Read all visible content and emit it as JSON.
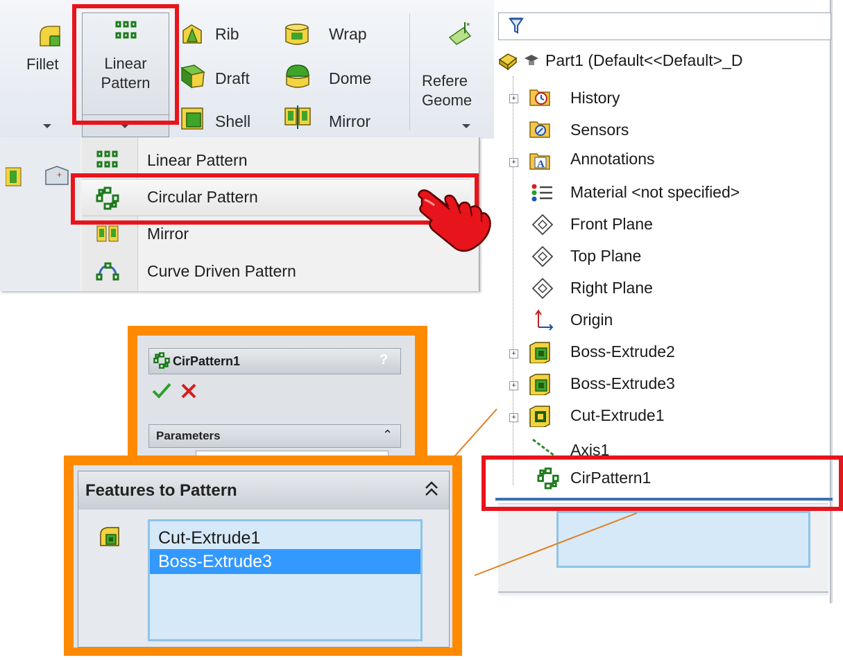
{
  "toolbar": {
    "fillet_label": "Fillet",
    "linear_pattern_line1": "Linear",
    "linear_pattern_line2": "Pattern",
    "rib_label": "Rib",
    "draft_label": "Draft",
    "shell_label": "Shell",
    "wrap_label": "Wrap",
    "dome_label": "Dome",
    "mirror_label": "Mirror",
    "ref_geometry_line1": "Refere",
    "ref_geometry_line2": "Geome"
  },
  "pattern_menu": {
    "items": [
      {
        "label": "Linear Pattern",
        "icon": "linear-pattern-icon"
      },
      {
        "label": "Circular Pattern",
        "icon": "circular-pattern-icon"
      },
      {
        "label": "Mirror",
        "icon": "mirror-icon"
      },
      {
        "label": "Curve Driven Pattern",
        "icon": "curve-pattern-icon"
      }
    ]
  },
  "feature_tree": {
    "root": "Part1  (Default<<Default>_D",
    "nodes": [
      {
        "label": "History",
        "icon": "history-icon",
        "expandable": true
      },
      {
        "label": "Sensors",
        "icon": "sensors-icon",
        "expandable": false
      },
      {
        "label": "Annotations",
        "icon": "annotations-icon",
        "expandable": true
      },
      {
        "label": "Material <not specified>",
        "icon": "material-icon",
        "expandable": false
      },
      {
        "label": "Front Plane",
        "icon": "plane-icon",
        "expandable": false
      },
      {
        "label": "Top Plane",
        "icon": "plane-icon",
        "expandable": false
      },
      {
        "label": "Right Plane",
        "icon": "plane-icon",
        "expandable": false
      },
      {
        "label": "Origin",
        "icon": "origin-icon",
        "expandable": false
      },
      {
        "label": "Boss-Extrude2",
        "icon": "boss-extrude-icon",
        "expandable": true
      },
      {
        "label": "Boss-Extrude3",
        "icon": "boss-extrude-icon",
        "expandable": true
      },
      {
        "label": "Cut-Extrude1",
        "icon": "cut-extrude-icon",
        "expandable": true
      },
      {
        "label": "Axis1",
        "icon": "axis-icon",
        "expandable": false
      },
      {
        "label": "CirPattern1",
        "icon": "circular-pattern-icon",
        "expandable": false
      }
    ]
  },
  "property_manager": {
    "title": "CirPattern1",
    "help": "?",
    "parameters_label": "Parameters"
  },
  "features_to_pattern": {
    "header": "Features to Pattern",
    "items": [
      "Cut-Extrude1",
      "Boss-Extrude3"
    ],
    "selected_index": 1
  },
  "colors": {
    "highlight_red": "#e8141b",
    "callout_orange": "#ff8a00",
    "selection_blue": "#3399ff",
    "list_bg": "#d6e9f8"
  }
}
